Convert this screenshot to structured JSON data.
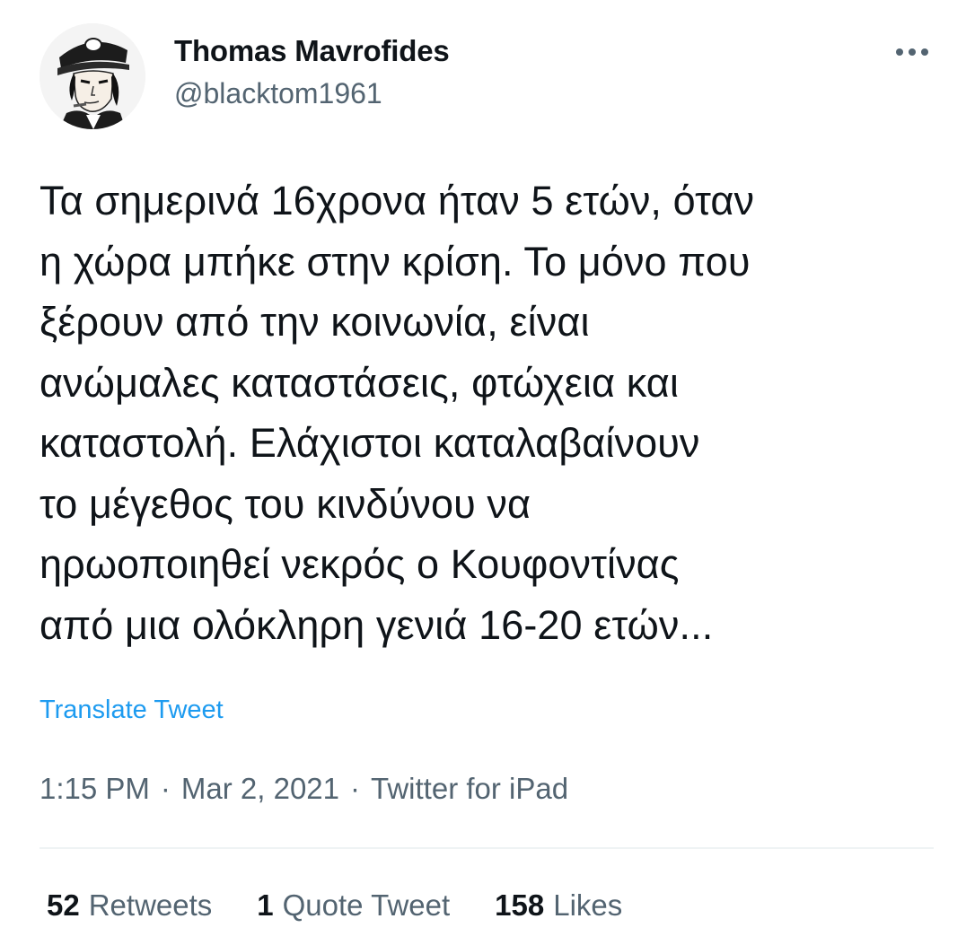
{
  "author": {
    "display_name": "Thomas Mavrofides",
    "handle": "@blacktom1961"
  },
  "tweet": {
    "text": "Τα σημερινά 16χρονα ήταν 5 ετών, όταν\nη χώρα μπήκε στην κρίση. Το μόνο που\nξέρουν από την κοινωνία, είναι\nανώμαλες καταστάσεις, φτώχεια και\nκαταστολή. Ελάχιστοι καταλαβαίνουν\nτο μέγεθος του κινδύνου να\nηρωοποιηθεί νεκρός ο Κουφοντίνας\nαπό μια ολόκληρη γενιά 16-20 ετών...",
    "translate_label": "Translate Tweet",
    "time": "1:15 PM",
    "date": "Mar 2, 2021",
    "source": "Twitter for iPad",
    "separator": "·"
  },
  "stats": {
    "retweets_count": "52",
    "retweets_label": "Retweets",
    "quotes_count": "1",
    "quotes_label": "Quote Tweet",
    "likes_count": "158",
    "likes_label": "Likes"
  },
  "icons": {
    "more": "more-horizontal-icon",
    "avatar": "avatar-illustration"
  },
  "colors": {
    "text_primary": "#0f1419",
    "text_secondary": "#536471",
    "link": "#1d9bf0",
    "divider": "#eff3f4"
  }
}
